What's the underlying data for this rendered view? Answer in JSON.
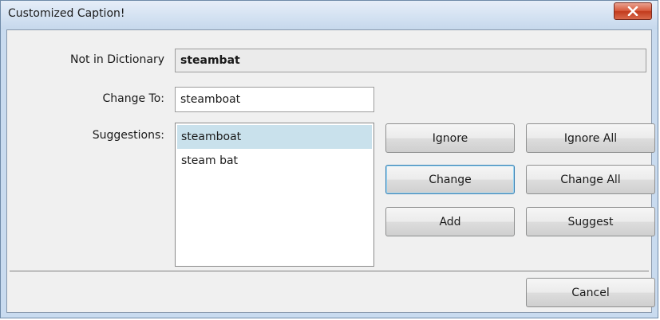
{
  "window": {
    "title": "Customized Caption!",
    "close_icon": "close-x-icon"
  },
  "form": {
    "not_in_dictionary_label": "Not in Dictionary",
    "not_in_dictionary_value": "steambat",
    "change_to_label": "Change To:",
    "change_to_value": "steamboat",
    "suggestions_label": "Suggestions:",
    "suggestions": [
      {
        "text": "steamboat",
        "selected": true
      },
      {
        "text": "steam bat",
        "selected": false
      }
    ]
  },
  "buttons": {
    "ignore": "Ignore",
    "ignore_all": "Ignore All",
    "change": "Change",
    "change_all": "Change All",
    "add": "Add",
    "suggest": "Suggest",
    "cancel": "Cancel"
  },
  "colors": {
    "close_button": "#c8432a",
    "selection": "#c9e1ec"
  }
}
